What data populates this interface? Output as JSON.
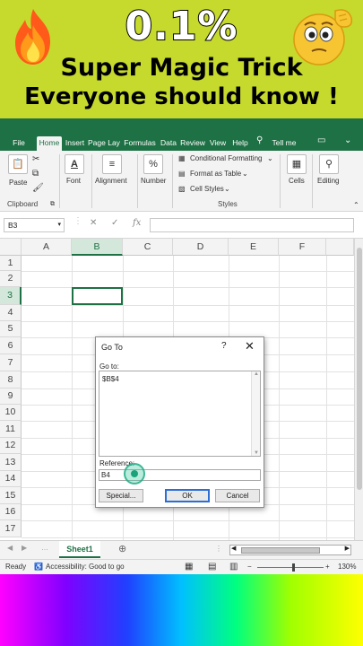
{
  "banner": {
    "headline": "0.1%",
    "line1": "Super Magic Trick",
    "line2": "Everyone should know !",
    "left_icon": "fire-icon",
    "right_icon": "thinking-face-icon",
    "background": "#c6d92d"
  },
  "ribbon_tabs": [
    "File",
    "Home",
    "Insert",
    "Page Layout",
    "Formulas",
    "Data",
    "Review",
    "View",
    "Help",
    "Tell me"
  ],
  "ribbon": {
    "paste": "Paste",
    "clipboard": "Clipboard",
    "font": "Font",
    "alignment": "Alignment",
    "number": "Number",
    "number_symbol": "%",
    "conditional_formatting": "Conditional Formatting",
    "format_as_table": "Format as Table",
    "cell_styles": "Cell Styles",
    "styles": "Styles",
    "cells": "Cells",
    "editing": "Editing"
  },
  "formula_bar": {
    "name_box": "B3",
    "fx": "fx"
  },
  "grid": {
    "columns": [
      "A",
      "B",
      "C",
      "D",
      "E",
      "F"
    ],
    "rows": [
      "1",
      "2",
      "3",
      "4",
      "5",
      "6",
      "7",
      "8",
      "9",
      "10",
      "11",
      "12",
      "13",
      "14",
      "15",
      "16",
      "17"
    ],
    "active_cell": "B3"
  },
  "sheets": {
    "active": "Sheet1",
    "add_icon": "plus-circle-icon"
  },
  "status": {
    "ready": "Ready",
    "accessibility": "Accessibility: Good to go",
    "zoom": "130%"
  },
  "dialog": {
    "title": "Go To",
    "help": "?",
    "goto_label": "Go to:",
    "list_items": [
      "$B$4"
    ],
    "reference_label": "Reference:",
    "reference_value": "B4",
    "special": "Special...",
    "ok": "OK",
    "cancel": "Cancel"
  },
  "colors": {
    "excel_green": "#1e7145",
    "ok_border": "#2b6fd6"
  }
}
